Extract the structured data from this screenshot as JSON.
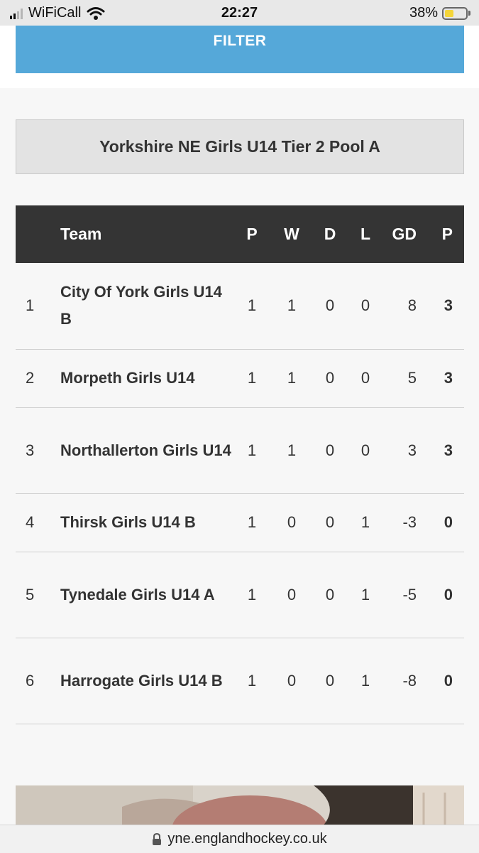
{
  "status_bar": {
    "carrier": "WiFiCall",
    "time": "22:27",
    "battery_percent": "38%",
    "battery_level": 0.38,
    "signal_bars_filled": 2
  },
  "filter": {
    "label": "FILTER",
    "color": "#55a8d9"
  },
  "pool": {
    "title": "Yorkshire NE Girls U14 Tier 2 Pool A"
  },
  "table": {
    "headers": {
      "pos": "",
      "team": "Team",
      "played": "P",
      "won": "W",
      "drawn": "D",
      "lost": "L",
      "gd": "GD",
      "points": "P"
    },
    "rows": [
      {
        "pos": "1",
        "team": "City Of York Girls U14 B",
        "played": "1",
        "won": "1",
        "drawn": "0",
        "lost": "0",
        "gd": "8",
        "points": "3"
      },
      {
        "pos": "2",
        "team": "Morpeth Girls U14",
        "played": "1",
        "won": "1",
        "drawn": "0",
        "lost": "0",
        "gd": "5",
        "points": "3"
      },
      {
        "pos": "3",
        "team": "Northallerton Girls U14",
        "played": "1",
        "won": "1",
        "drawn": "0",
        "lost": "0",
        "gd": "3",
        "points": "3"
      },
      {
        "pos": "4",
        "team": "Thirsk Girls U14 B",
        "played": "1",
        "won": "0",
        "drawn": "0",
        "lost": "1",
        "gd": "-3",
        "points": "0"
      },
      {
        "pos": "5",
        "team": "Tynedale Girls U14 A",
        "played": "1",
        "won": "0",
        "drawn": "0",
        "lost": "1",
        "gd": "-5",
        "points": "0"
      },
      {
        "pos": "6",
        "team": "Harrogate Girls U14 B",
        "played": "1",
        "won": "0",
        "drawn": "0",
        "lost": "1",
        "gd": "-8",
        "points": "0"
      }
    ]
  },
  "browser": {
    "url": "yne.englandhockey.co.uk"
  },
  "colors": {
    "link": "#4ba3d6",
    "header_bg": "#343434",
    "battery": "#f4d53a"
  }
}
